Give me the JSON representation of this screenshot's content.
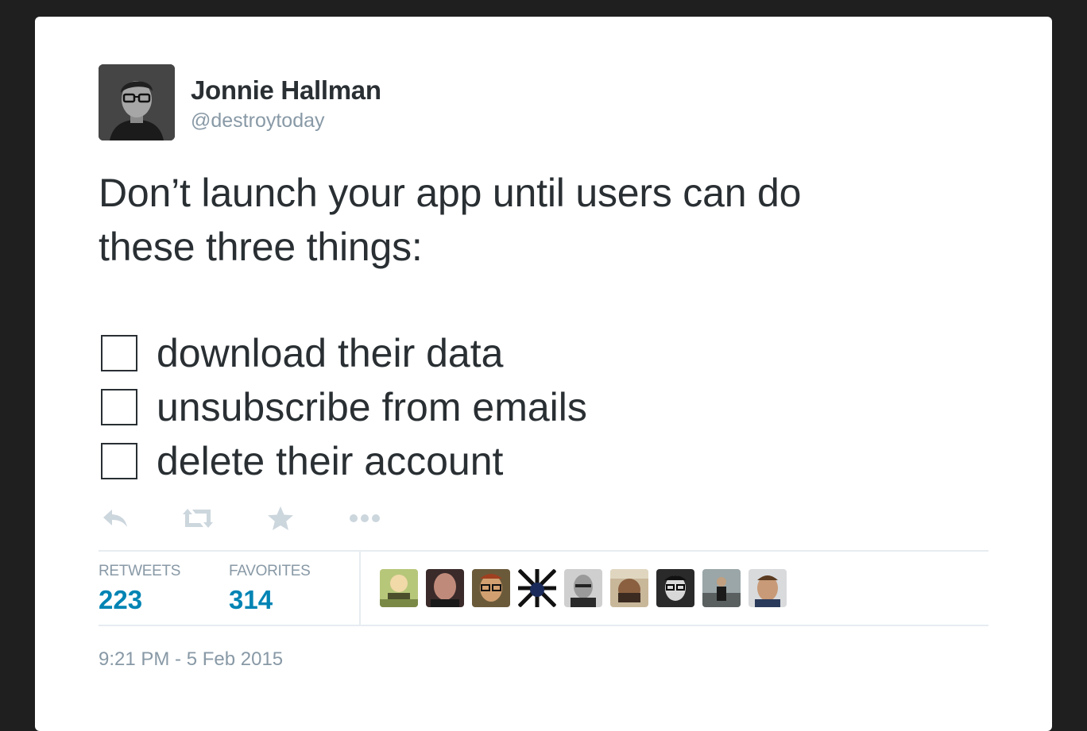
{
  "author": {
    "name": "Jonnie Hallman",
    "handle": "@destroytoday"
  },
  "tweet": {
    "intro_line1": "Don’t launch your app until users can do",
    "intro_line2": "these three things:",
    "checklist": [
      {
        "label": "download their data",
        "checked": false
      },
      {
        "label": "unsubscribe from emails",
        "checked": false
      },
      {
        "label": "delete their account",
        "checked": false
      }
    ]
  },
  "actions": {
    "reply_icon": "reply-icon",
    "retweet_icon": "retweet-icon",
    "favorite_icon": "star-icon",
    "more_icon": "more-icon"
  },
  "stats": {
    "retweets_label": "RETWEETS",
    "retweets_count": "223",
    "favorites_label": "FAVORITES",
    "favorites_count": "314"
  },
  "favoriters_count": 9,
  "timestamp": "9:21 PM - 5 Feb 2015",
  "colors": {
    "background": "#1f1f1f",
    "card": "#ffffff",
    "text": "#292f33",
    "muted": "#8899a6",
    "link": "#0084b4",
    "icon": "#ccd6dd",
    "divider": "#e6ecf0"
  }
}
